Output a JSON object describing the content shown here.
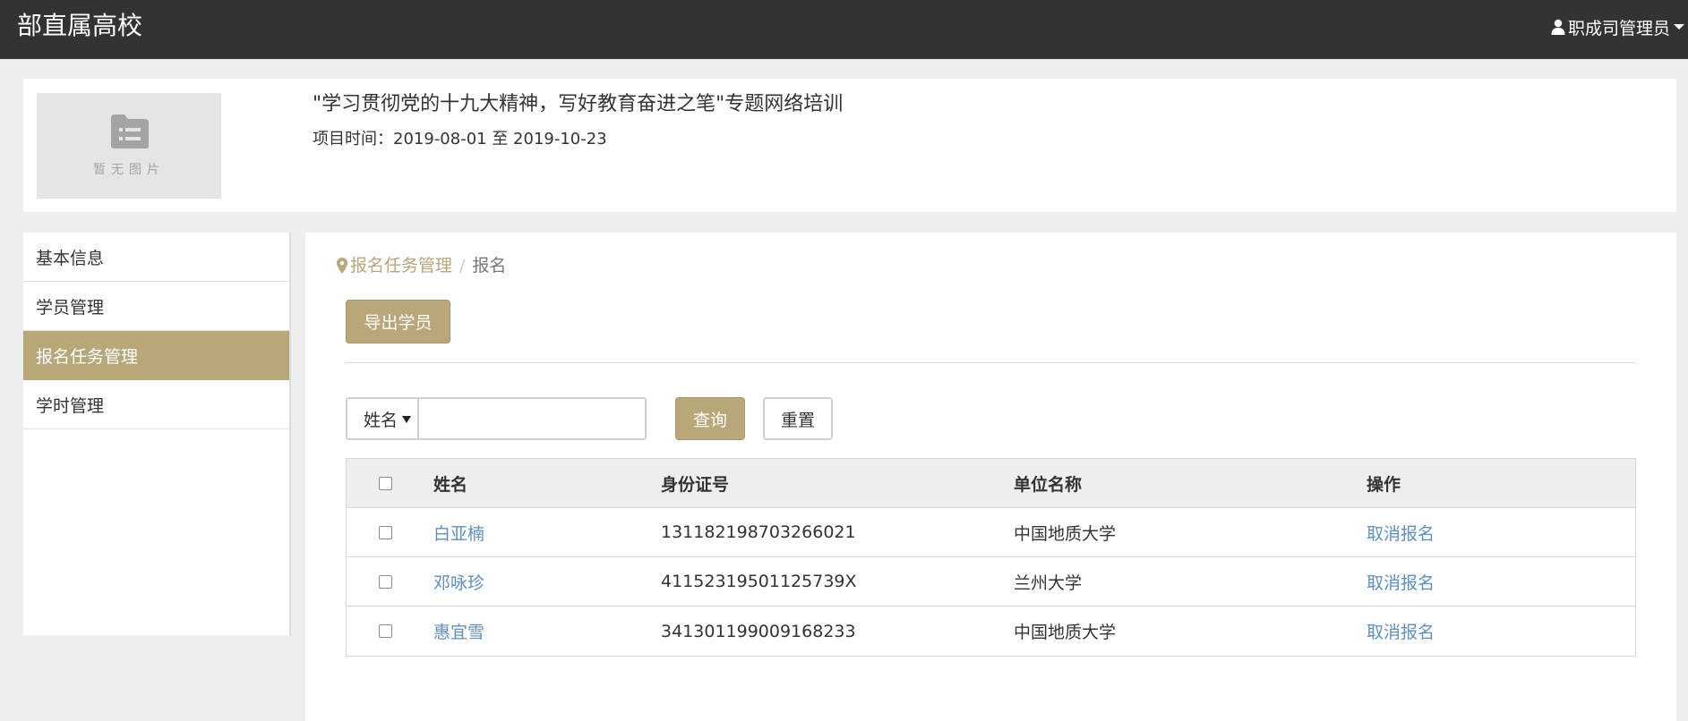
{
  "header": {
    "brand": "部直属高校",
    "user_label": "职成司管理员",
    "user_icon": "user-icon"
  },
  "project": {
    "image_placeholder": "暂无图片",
    "title": "\"学习贯彻党的十九大精神，写好教育奋进之笔\"专题网络培训",
    "time": "项目时间：2019-08-01 至 2019-10-23"
  },
  "sidebar": {
    "items": [
      {
        "label": "基本信息",
        "active": false
      },
      {
        "label": "学员管理",
        "active": false
      },
      {
        "label": "报名任务管理",
        "active": true
      },
      {
        "label": "学时管理",
        "active": false
      }
    ]
  },
  "breadcrumb": {
    "parent": "报名任务管理",
    "separator": "/",
    "current": "报名"
  },
  "toolbar": {
    "export_label": "导出学员"
  },
  "filter": {
    "field_selected": "姓名",
    "keyword_value": "",
    "query_label": "查询",
    "reset_label": "重置"
  },
  "table": {
    "columns": [
      "姓名",
      "身份证号",
      "单位名称",
      "操作"
    ],
    "rows": [
      {
        "name": "白亚楠",
        "id_number": "131182198703266021",
        "unit": "中国地质大学",
        "action": "取消报名"
      },
      {
        "name": "邓咏珍",
        "id_number": "41152319501125739X",
        "unit": "兰州大学",
        "action": "取消报名"
      },
      {
        "name": "惠宜雪",
        "id_number": "341301199009168233",
        "unit": "中国地质大学",
        "action": "取消报名"
      }
    ]
  },
  "colors": {
    "accent": "#b9a679",
    "topbar": "#333333",
    "link": "#5a8fc8",
    "background": "#eceef0"
  }
}
